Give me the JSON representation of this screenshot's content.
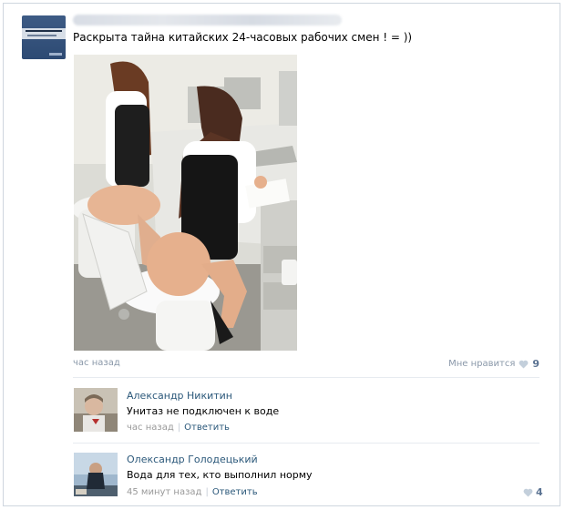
{
  "post": {
    "text": "Раскрыта тайна китайских 24-часовых рабочих смен ! = ))",
    "time": "час назад",
    "like_label": "Мне нравится",
    "like_count": "9"
  },
  "comments": [
    {
      "author": "Александр Никитин",
      "text": "Унитаз не подключен к воде",
      "time": "час назад",
      "reply": "Ответить"
    },
    {
      "author": "Олександр Голодецький",
      "text": "Вода для тех, кто выполнил норму",
      "time": "45 минут назад",
      "reply": "Ответить",
      "like_count": "4"
    }
  ],
  "colors": {
    "link": "#2b587a",
    "meta": "#8a98a9",
    "heart": "#c3cfdb"
  },
  "icons": [
    "heart-icon"
  ]
}
